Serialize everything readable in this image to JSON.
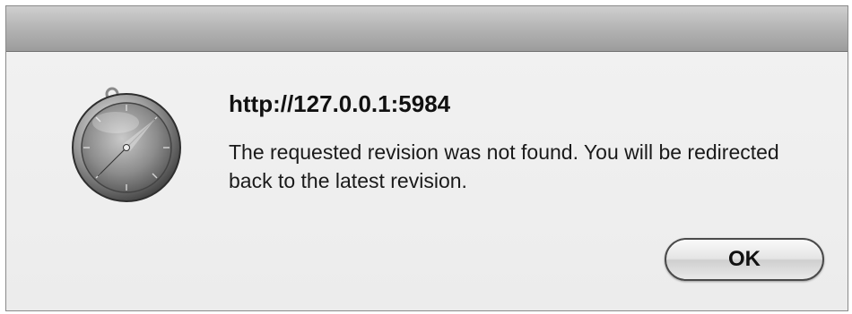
{
  "dialog": {
    "title": "http://127.0.0.1:5984",
    "message": "The requested revision was not found. You will be redirected back to the latest revision.",
    "ok_label": "OK",
    "icon": "safari-compass-icon"
  },
  "colors": {
    "window_background": "#ececec",
    "titlebar_gradient_top": "#cfcfcf",
    "titlebar_gradient_bottom": "#9c9c9c",
    "text": "#111111"
  }
}
